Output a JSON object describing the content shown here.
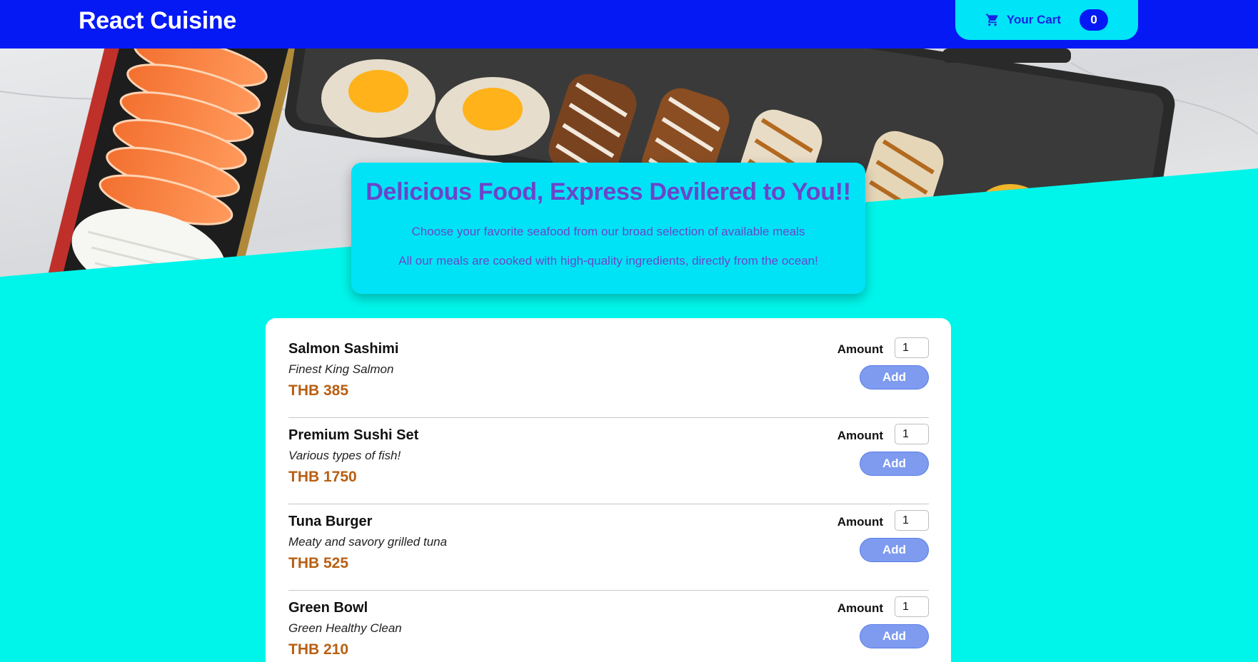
{
  "header": {
    "brand": "React Cuisine",
    "cart": {
      "label": "Your Cart",
      "count": "0",
      "icon": "cart-icon"
    }
  },
  "colors": {
    "header_bg": "#0519f5",
    "page_bg": "#00f5ea",
    "accent_title": "#6b45c9",
    "price": "#b85f12",
    "add_button": "#7e9bf0"
  },
  "summary": {
    "title": "Delicious Food, Express Devilered to You!!",
    "line1": "Choose your favorite seafood from our broad selection of available meals",
    "line2": "All our meals are cooked with high-quality ingredients, directly from the ocean!"
  },
  "meals": [
    {
      "name": "Salmon Sashimi",
      "description": "Finest King Salmon",
      "price": "THB 385",
      "amount_label": "Amount",
      "amount": "1",
      "add_label": "Add"
    },
    {
      "name": "Premium Sushi Set",
      "description": "Various types of fish!",
      "price": "THB 1750",
      "amount_label": "Amount",
      "amount": "1",
      "add_label": "Add"
    },
    {
      "name": "Tuna Burger",
      "description": "Meaty and savory grilled tuna",
      "price": "THB 525",
      "amount_label": "Amount",
      "amount": "1",
      "add_label": "Add"
    },
    {
      "name": "Green Bowl",
      "description": "Green Healthy Clean",
      "price": "THB 210",
      "amount_label": "Amount",
      "amount": "1",
      "add_label": "Add"
    }
  ]
}
